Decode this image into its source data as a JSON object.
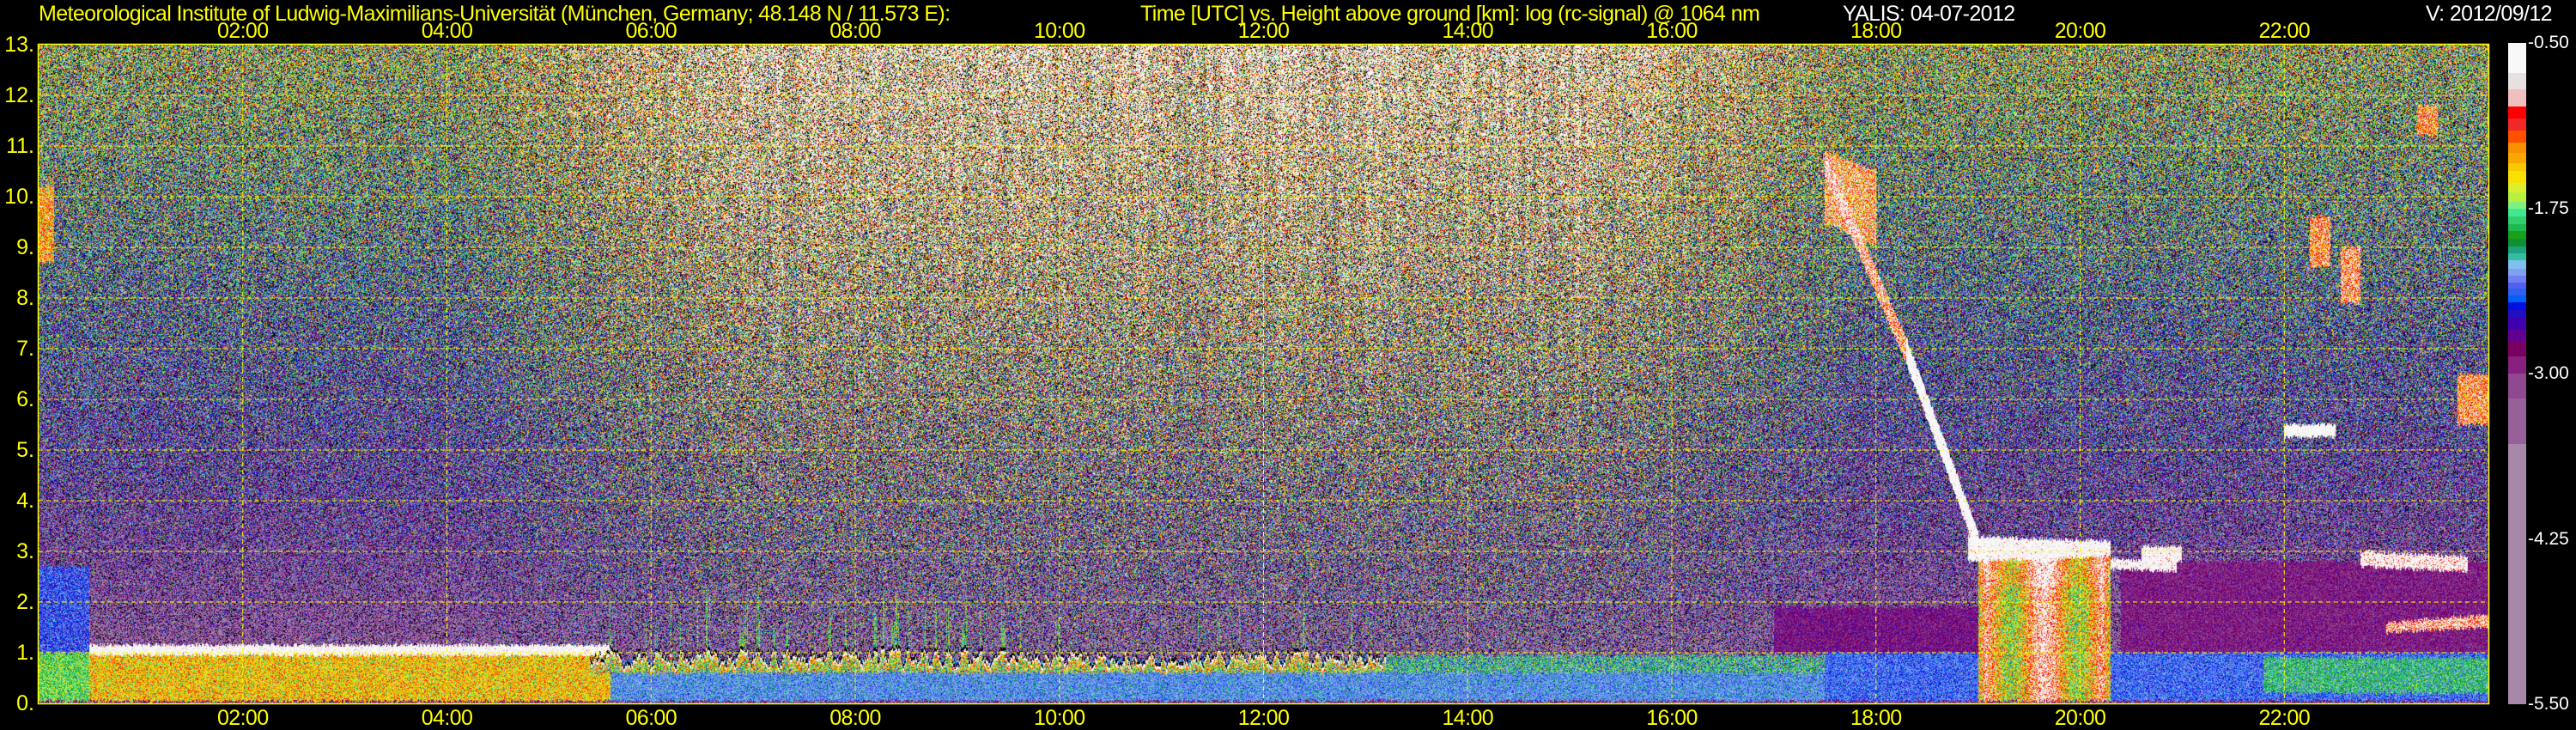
{
  "header": {
    "institute": "Meteorological Institute of Ludwig-Maximilians-Universität (München, Germany; 48.148 N / 11.573 E):",
    "axes_description": "Time [UTC] vs. Height above ground [km]: log (rc-signal) @ 1064 nm",
    "instrument_date": "YALIS: 04-07-2012",
    "version": "V: 2012/09/12"
  },
  "chart_data": {
    "type": "heatmap",
    "title": "Time [UTC] vs. Height above ground [km]: log (rc-signal) @ 1064 nm",
    "xlabel": "Time [UTC]",
    "ylabel": "Height above ground [km]",
    "value_label": "log (rc-signal)",
    "xlim": [
      0,
      24
    ],
    "ylim": [
      0,
      13
    ],
    "grid": true,
    "x_ticks": [
      {
        "value": 2,
        "label": "02:00"
      },
      {
        "value": 4,
        "label": "04:00"
      },
      {
        "value": 6,
        "label": "06:00"
      },
      {
        "value": 8,
        "label": "08:00"
      },
      {
        "value": 10,
        "label": "10:00"
      },
      {
        "value": 12,
        "label": "12:00"
      },
      {
        "value": 14,
        "label": "14:00"
      },
      {
        "value": 16,
        "label": "16:00"
      },
      {
        "value": 18,
        "label": "18:00"
      },
      {
        "value": 20,
        "label": "20:00"
      },
      {
        "value": 22,
        "label": "22:00"
      }
    ],
    "y_ticks": [
      {
        "value": 0,
        "label": "0."
      },
      {
        "value": 1,
        "label": "1."
      },
      {
        "value": 2,
        "label": "2."
      },
      {
        "value": 3,
        "label": "3."
      },
      {
        "value": 4,
        "label": "4."
      },
      {
        "value": 5,
        "label": "5."
      },
      {
        "value": 6,
        "label": "6."
      },
      {
        "value": 7,
        "label": "7."
      },
      {
        "value": 8,
        "label": "8."
      },
      {
        "value": 9,
        "label": "9."
      },
      {
        "value": 10,
        "label": "10."
      },
      {
        "value": 11,
        "label": "11."
      },
      {
        "value": 12,
        "label": "12."
      },
      {
        "value": 13,
        "label": "13."
      }
    ],
    "colorbar": {
      "range": [
        -5.5,
        -0.5
      ],
      "ticks": [
        {
          "value": -0.5,
          "label": "-0.50"
        },
        {
          "value": -1.75,
          "label": "-1.75"
        },
        {
          "value": -3.0,
          "label": "-3.00"
        },
        {
          "value": -4.25,
          "label": "-4.25"
        },
        {
          "value": -5.5,
          "label": "-5.50"
        }
      ],
      "stops": [
        [
          -0.5,
          -0.73,
          "#f8f8f8"
        ],
        [
          -0.73,
          -0.85,
          "#e8e0e0"
        ],
        [
          -0.85,
          -0.98,
          "#f0c0c0"
        ],
        [
          -0.98,
          -1.07,
          "#ff0000"
        ],
        [
          -1.07,
          -1.16,
          "#f02828"
        ],
        [
          -1.16,
          -1.25,
          "#ff5000"
        ],
        [
          -1.25,
          -1.33,
          "#f89000"
        ],
        [
          -1.33,
          -1.41,
          "#f8a800"
        ],
        [
          -1.41,
          -1.47,
          "#f8c800"
        ],
        [
          -1.47,
          -1.56,
          "#f8e000"
        ],
        [
          -1.56,
          -1.63,
          "#d8f030"
        ],
        [
          -1.63,
          -1.7,
          "#b8f040"
        ],
        [
          -1.7,
          -1.75,
          "#80f080"
        ],
        [
          -1.75,
          -1.81,
          "#40e890"
        ],
        [
          -1.81,
          -1.87,
          "#30d070"
        ],
        [
          -1.87,
          -1.92,
          "#20b850"
        ],
        [
          -1.92,
          -1.98,
          "#18a018"
        ],
        [
          -1.98,
          -2.04,
          "#109030"
        ],
        [
          -2.04,
          -2.09,
          "#20a080"
        ],
        [
          -2.09,
          -2.14,
          "#30c0a0"
        ],
        [
          -2.14,
          -2.21,
          "#80c0f0"
        ],
        [
          -2.21,
          -2.26,
          "#80a0f0"
        ],
        [
          -2.26,
          -2.31,
          "#7080f0"
        ],
        [
          -2.31,
          -2.36,
          "#5060f0"
        ],
        [
          -2.36,
          -2.41,
          "#3060f0"
        ],
        [
          -2.41,
          -2.46,
          "#0060f8"
        ],
        [
          -2.46,
          -2.52,
          "#0010e0"
        ],
        [
          -2.52,
          -2.58,
          "#2010c0"
        ],
        [
          -2.58,
          -2.67,
          "#4000b0"
        ],
        [
          -2.67,
          -2.75,
          "#600090"
        ],
        [
          -2.75,
          -2.87,
          "#780060"
        ],
        [
          -2.87,
          -3.0,
          "#882080"
        ],
        [
          -3.0,
          -3.19,
          "#904890"
        ],
        [
          -3.19,
          -3.53,
          "#986098"
        ],
        [
          -3.53,
          -5.5,
          "#a888a8"
        ]
      ]
    },
    "background_model": {
      "night_value_at_ground": -3.7,
      "night_value_at_top": -1.7,
      "daylight_increase_at_top": 1.0,
      "sunrise_hours": [
        4,
        7
      ],
      "sunset_hours": [
        15,
        18
      ],
      "noise_std_night": 0.55,
      "noise_std_day": 0.85,
      "no_signal_fraction": 0.12
    },
    "features": [
      {
        "name": "surface-band",
        "t": [
          0,
          24
        ],
        "base": [
          0,
          0
        ],
        "top": [
          0.04,
          0.04
        ],
        "value": -2.9,
        "noise": 0.1,
        "mode": "set"
      },
      {
        "name": "residual-layer",
        "t": [
          0,
          0.5
        ],
        "base": [
          0.04,
          0.04
        ],
        "top": [
          2.7,
          2.7
        ],
        "value": -2.4,
        "noise": 0.15,
        "mode": "set"
      },
      {
        "name": "boundary-layer-early",
        "t": [
          0,
          0.5
        ],
        "base": [
          0.04,
          0.04
        ],
        "top": [
          1.0,
          1.0
        ],
        "value": -1.8,
        "noise": 0.2,
        "mode": "set"
      },
      {
        "name": "boundary-layer-morning",
        "t": [
          0.5,
          5.6
        ],
        "base": [
          0.04,
          0.04
        ],
        "top": [
          1.0,
          1.0
        ],
        "value": -1.45,
        "noise": 0.22,
        "mode": "set"
      },
      {
        "name": "stratocumulus-cap",
        "t": [
          0.5,
          5.6
        ],
        "base": [
          0.95,
          0.95
        ],
        "top": [
          1.15,
          1.15
        ],
        "value": -0.6,
        "noise": 0.15,
        "mode": "max"
      },
      {
        "name": "boundary-layer-day",
        "t": [
          5.6,
          17.5
        ],
        "base": [
          0.04,
          0.04
        ],
        "top": [
          0.85,
          0.85
        ],
        "value": -2.25,
        "noise": 0.12,
        "mode": "set"
      },
      {
        "name": "cumulus-tops",
        "t": [
          5.4,
          13.2
        ],
        "base": [
          0.6,
          0.6
        ],
        "top": [
          1.05,
          1.05
        ],
        "value": -1.3,
        "noise": 0.4,
        "mode": "set",
        "texture": "spiky"
      },
      {
        "name": "cumulus-afternoon",
        "t": [
          13.2,
          17.5
        ],
        "base": [
          0.6,
          0.6
        ],
        "top": [
          0.95,
          0.95
        ],
        "value": -2.05,
        "noise": 0.3,
        "mode": "set"
      },
      {
        "name": "boundary-layer-evening",
        "t": [
          17.5,
          24
        ],
        "base": [
          0.04,
          0.04
        ],
        "top": [
          1.0,
          1.0
        ],
        "value": -2.35,
        "noise": 0.12,
        "mode": "set"
      },
      {
        "name": "aerosol-evening",
        "t": [
          17.0,
          19.0
        ],
        "base": [
          1.0,
          1.0
        ],
        "top": [
          1.9,
          1.9
        ],
        "value": -2.85,
        "noise": 0.15,
        "mode": "set"
      },
      {
        "name": "aerosol-night",
        "t": [
          20.4,
          24
        ],
        "base": [
          1.0,
          1.0
        ],
        "top": [
          2.8,
          2.8
        ],
        "value": -2.9,
        "noise": 0.15,
        "mode": "set"
      },
      {
        "name": "low-layer-night",
        "t": [
          21.8,
          24
        ],
        "base": [
          0.2,
          0.2
        ],
        "top": [
          0.9,
          0.9
        ],
        "value": -2.0,
        "noise": 0.2,
        "mode": "set"
      },
      {
        "name": "low-cloud-late",
        "t": [
          23.0,
          24
        ],
        "base": [
          1.4,
          1.5
        ],
        "top": [
          1.6,
          1.75
        ],
        "value": -0.9,
        "noise": 0.3,
        "mode": "max"
      },
      {
        "name": "cirrus-early",
        "t": [
          0,
          0.15
        ],
        "base": [
          8.7,
          8.7
        ],
        "top": [
          10.2,
          10.2
        ],
        "value": -1.3,
        "noise": 0.3,
        "mode": "max"
      },
      {
        "name": "plume-top",
        "t": [
          17.5,
          18.0
        ],
        "base": [
          9.5,
          9.0
        ],
        "top": [
          10.9,
          10.5
        ],
        "value": -1.1,
        "noise": 0.4,
        "mode": "max"
      },
      {
        "name": "slant-cloud-upper",
        "t": [
          17.5,
          18.3
        ],
        "base": [
          10.4,
          6.7
        ],
        "top": [
          10.9,
          7.2
        ],
        "value": -0.9,
        "noise": 0.35,
        "mode": "max"
      },
      {
        "name": "slant-cloud-lower",
        "t": [
          18.3,
          19.0
        ],
        "base": [
          6.7,
          2.9
        ],
        "top": [
          7.2,
          3.4
        ],
        "value": -0.5,
        "noise": 0.2,
        "mode": "max"
      },
      {
        "name": "rain-shaft",
        "t": [
          19.0,
          20.3
        ],
        "base": [
          0.04,
          0.04
        ],
        "top": [
          3.0,
          2.9
        ],
        "value": -1.0,
        "noise": 0.3,
        "mode": "max",
        "texture": "rain"
      },
      {
        "name": "rain-cloud-cap",
        "t": [
          18.9,
          20.3
        ],
        "base": [
          2.8,
          2.9
        ],
        "top": [
          3.3,
          3.2
        ],
        "value": -0.55,
        "noise": 0.2,
        "mode": "max"
      },
      {
        "name": "cloud-2030",
        "t": [
          20.3,
          20.95
        ],
        "base": [
          2.65,
          2.6
        ],
        "top": [
          2.85,
          2.8
        ],
        "value": -0.6,
        "noise": 0.2,
        "mode": "max"
      },
      {
        "name": "midlevel-cloud",
        "t": [
          22.0,
          22.5
        ],
        "base": [
          5.25,
          5.25
        ],
        "top": [
          5.5,
          5.5
        ],
        "value": -0.5,
        "noise": 0.15,
        "mode": "max"
      },
      {
        "name": "cloud-2300",
        "t": [
          22.75,
          23.8
        ],
        "base": [
          2.7,
          2.6
        ],
        "top": [
          3.0,
          2.9
        ],
        "value": -0.6,
        "noise": 0.3,
        "mode": "max"
      },
      {
        "name": "cloud-2045",
        "t": [
          20.6,
          21.0
        ],
        "base": [
          2.8,
          2.8
        ],
        "top": [
          3.1,
          3.1
        ],
        "value": -0.6,
        "noise": 0.2,
        "mode": "max"
      },
      {
        "name": "cirrus-fall-1",
        "t": [
          22.25,
          22.45
        ],
        "base": [
          8.6,
          8.6
        ],
        "top": [
          9.6,
          9.6
        ],
        "value": -1.1,
        "noise": 0.3,
        "mode": "max"
      },
      {
        "name": "cirrus-fall-2",
        "t": [
          22.55,
          22.75
        ],
        "base": [
          7.9,
          7.9
        ],
        "top": [
          9.0,
          9.0
        ],
        "value": -1.0,
        "noise": 0.3,
        "mode": "max"
      },
      {
        "name": "cirrus-high",
        "t": [
          23.3,
          23.5
        ],
        "base": [
          11.2,
          11.2
        ],
        "top": [
          11.8,
          11.8
        ],
        "value": -1.2,
        "noise": 0.3,
        "mode": "max"
      },
      {
        "name": "cirrus-late",
        "t": [
          23.7,
          24
        ],
        "base": [
          5.5,
          5.5
        ],
        "top": [
          6.5,
          6.5
        ],
        "value": -1.1,
        "noise": 0.3,
        "mode": "max"
      }
    ]
  }
}
